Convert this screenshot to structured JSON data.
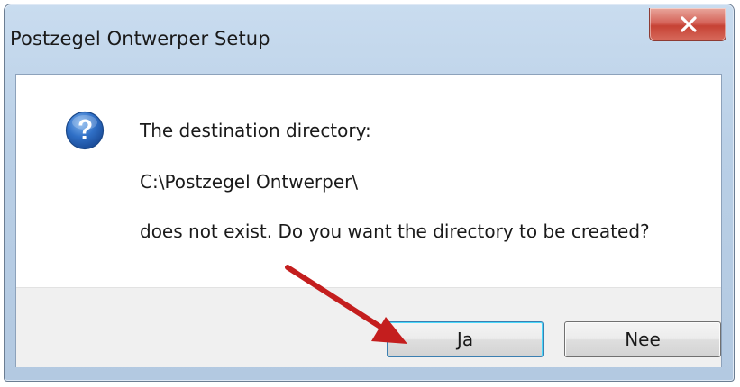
{
  "window": {
    "title": "Postzegel Ontwerper Setup",
    "close_glyph": "x"
  },
  "message": {
    "icon": "question-icon",
    "line1": "The destination directory:",
    "path": "C:\\Postzegel Ontwerper\\",
    "line3": "does not exist. Do you want the directory to be created?"
  },
  "buttons": {
    "yes_label": "Ja",
    "no_label": "Nee"
  },
  "colors": {
    "annotation_arrow": "#c41e1e",
    "icon_blue": "#2f6fc6",
    "close_red": "#c64234"
  }
}
